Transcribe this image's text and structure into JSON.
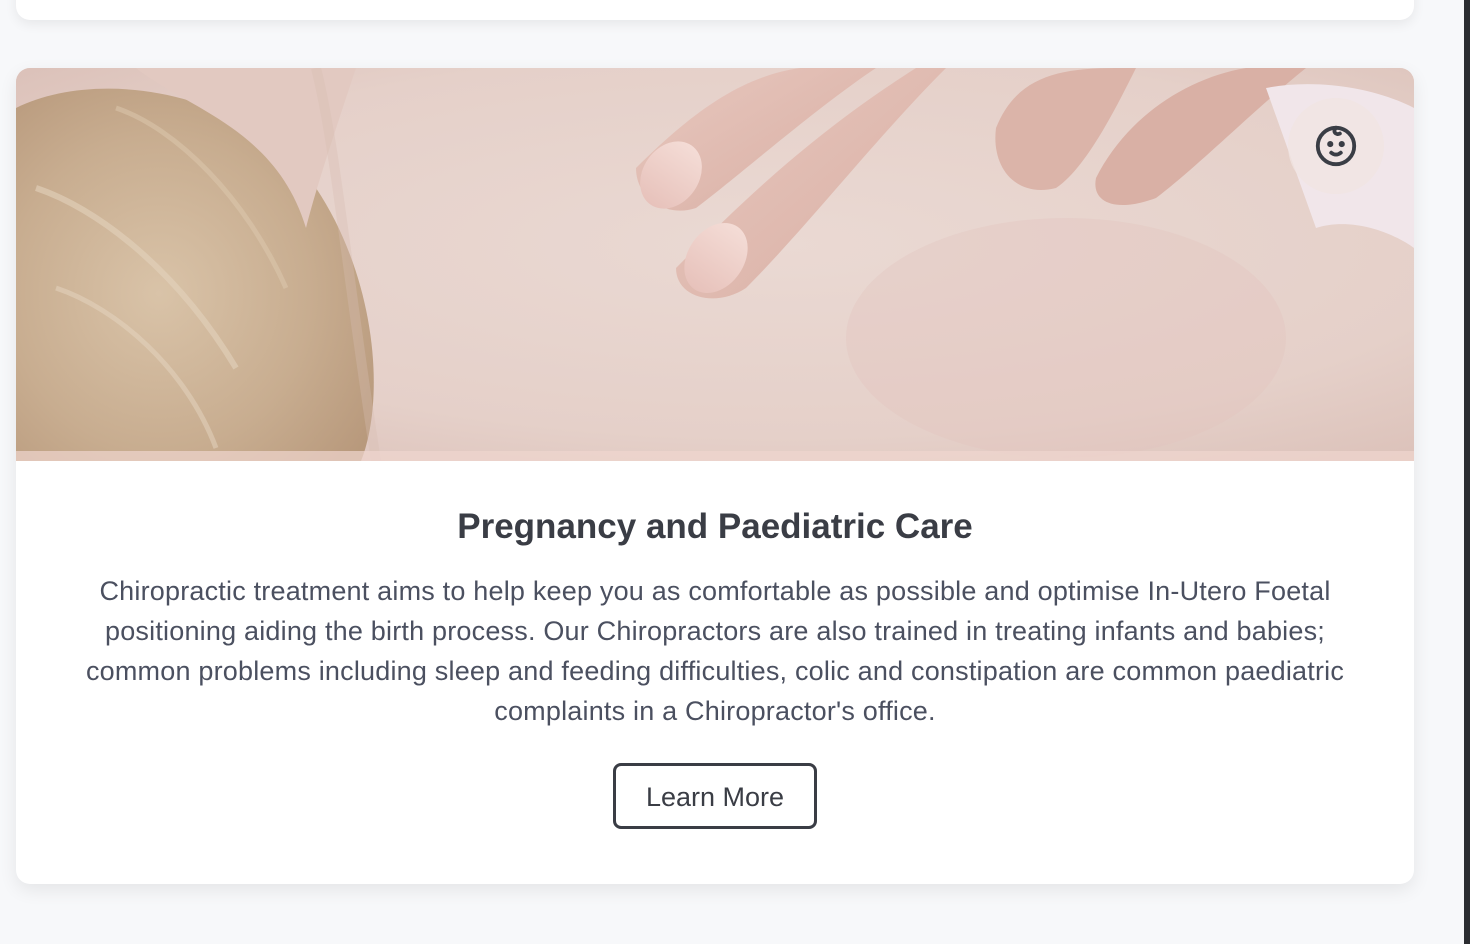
{
  "service_card": {
    "title": "Pregnancy and Paediatric Care",
    "description": "Chiropractic treatment aims to help keep you as comfortable as possible and optimise In-Utero Foetal positioning aiding the birth process. Our Chiropractors are also trained in treating infants and babies; common problems including sleep and feeding difficulties, colic and constipation are common paediatric complaints in a Chiropractor's office.",
    "button_label": "Learn More",
    "icon": "baby-face-icon"
  },
  "colors": {
    "page_background": "#f7f8fa",
    "card_background": "#ffffff",
    "title_text": "#3a3d45",
    "body_text": "#4b5060",
    "button_border": "#3a3d45"
  }
}
